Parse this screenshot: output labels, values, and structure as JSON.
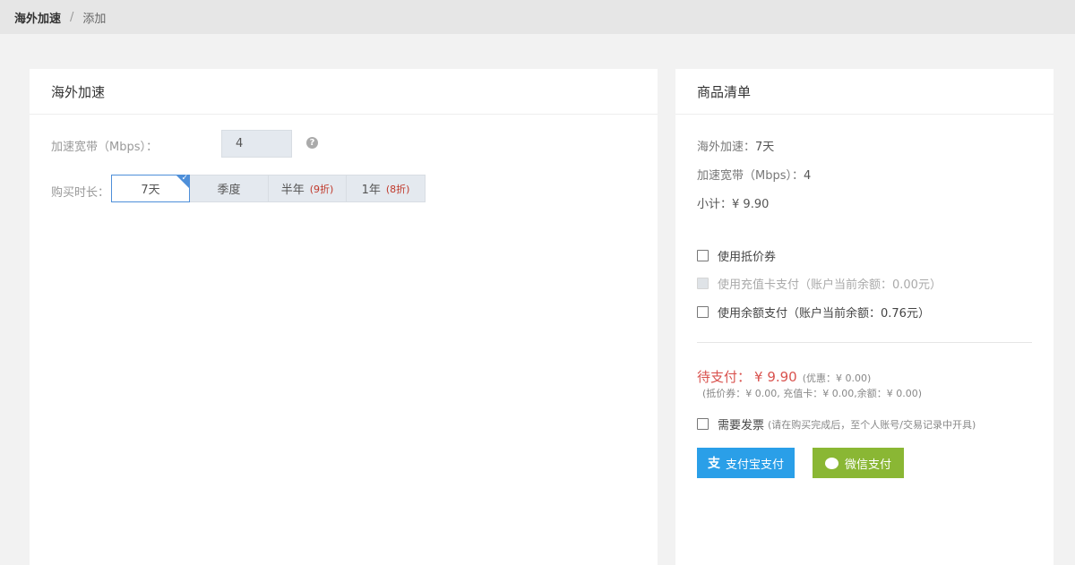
{
  "breadcrumb": {
    "root": "海外加速",
    "sep": "/",
    "current": "添加"
  },
  "left": {
    "title": "海外加速",
    "bandwidth_label": "加速宽带（Mbps）：",
    "bandwidth_value": "4",
    "help_icon": "?",
    "duration_label": "购买时长：",
    "duration_options": [
      {
        "label": "7天",
        "discount": ""
      },
      {
        "label": "季度",
        "discount": ""
      },
      {
        "label": "半年",
        "discount": "(9折)"
      },
      {
        "label": "1年",
        "discount": "(8折)"
      }
    ],
    "selected_index": 0
  },
  "right": {
    "title": "商品清单",
    "item_label": "海外加速：",
    "item_value": "7天",
    "bw_label": "加速宽带（Mbps）：",
    "bw_value": "4",
    "subtotal_label": "小计：",
    "subtotal_value": "¥ 9.90",
    "opt_coupon": "使用抵价券",
    "opt_card": "使用充值卡支付（账户当前余额：0.00元）",
    "opt_balance": "使用余额支付（账户当前余额：0.76元）",
    "total_label": "待支付：",
    "total_value": "¥ 9.90",
    "total_discount": "(优惠：¥ 0.00)",
    "total_detail": "(抵价券：¥ 0.00, 充值卡：¥ 0.00,余额：¥ 0.00)",
    "invoice_label": "需要发票",
    "invoice_note": "(请在购买完成后，至个人账号/交易记录中开具)",
    "alipay_label": "支付宝支付",
    "wechat_label": "微信支付"
  },
  "colors": {
    "accent_blue": "#4e8fd9",
    "alipay": "#2a9fe8",
    "wechat": "#8ab734",
    "price_red": "#d9534f"
  },
  "icons": {
    "help": "question-circle-icon",
    "check": "check-icon",
    "alipay": "alipay-icon",
    "wechat": "wechat-icon"
  }
}
